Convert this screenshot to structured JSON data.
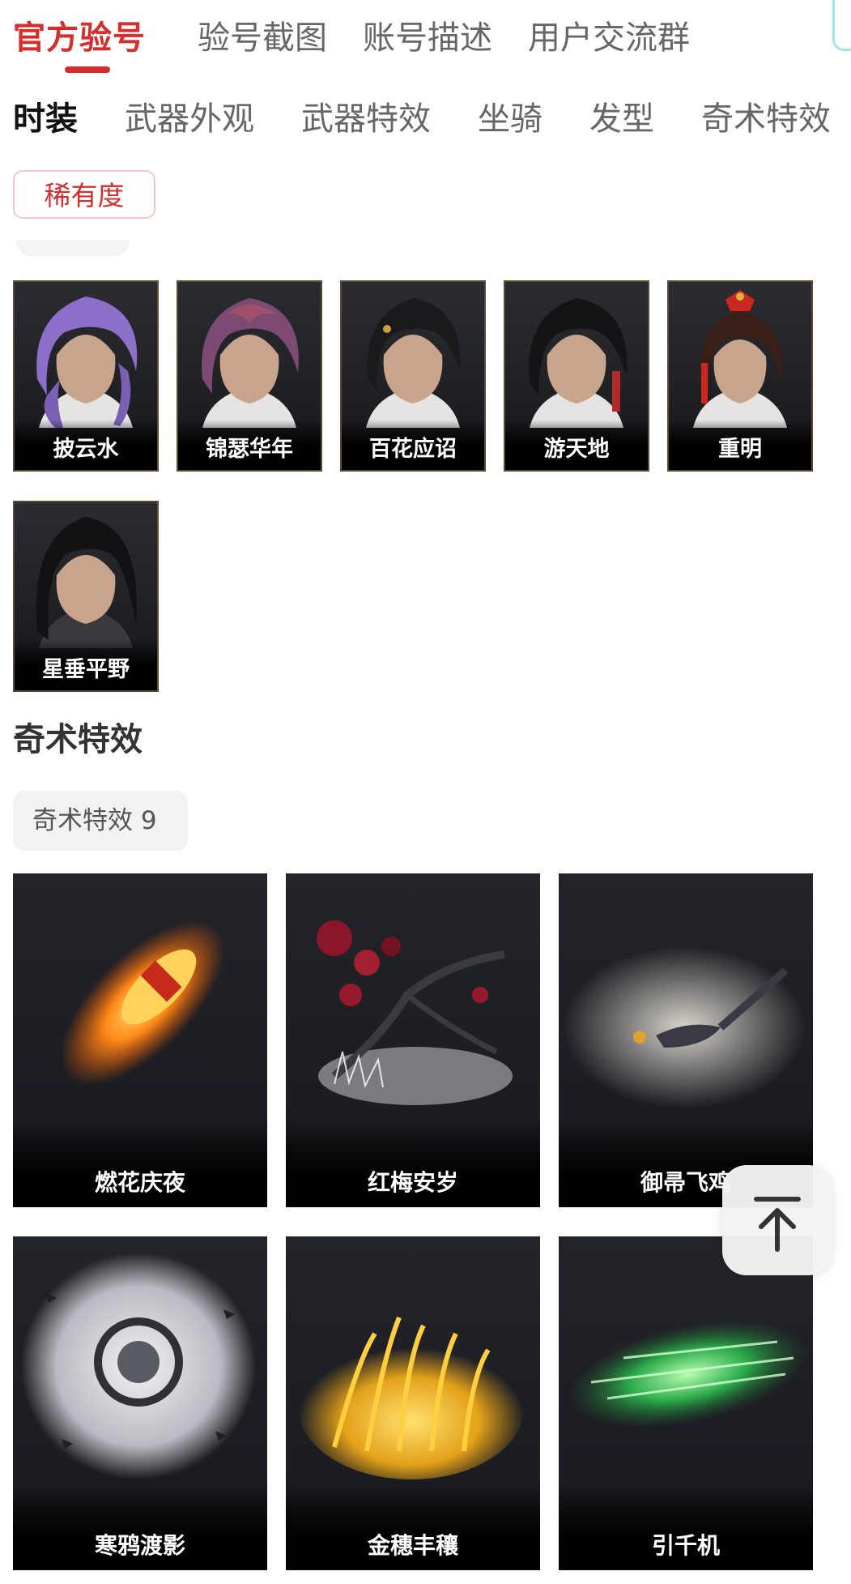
{
  "top_tabs": [
    "官方验号",
    "验号截图",
    "账号描述",
    "用户交流群"
  ],
  "category_tabs": [
    "时装",
    "武器外观",
    "武器特效",
    "坐骑",
    "发型",
    "奇术特效"
  ],
  "filter": {
    "rarity_label": "稀有度"
  },
  "costumes": [
    "披云水",
    "锦瑟华年",
    "百花应诏",
    "游天地",
    "重明",
    "星垂平野"
  ],
  "section": {
    "title": "奇术特效",
    "chip_label": "奇术特效",
    "chip_count": "9"
  },
  "effects": [
    "燃花庆夜",
    "红梅安岁",
    "御帚飞鸡",
    "寒鸦渡影",
    "金穗丰穰",
    "引千机"
  ],
  "colors": {
    "accent": "#d62d2d",
    "card_bg": "#1d1e22",
    "card_border": "#5d4a33"
  },
  "icons": {
    "back_to_top": "arrow-up-icon"
  }
}
